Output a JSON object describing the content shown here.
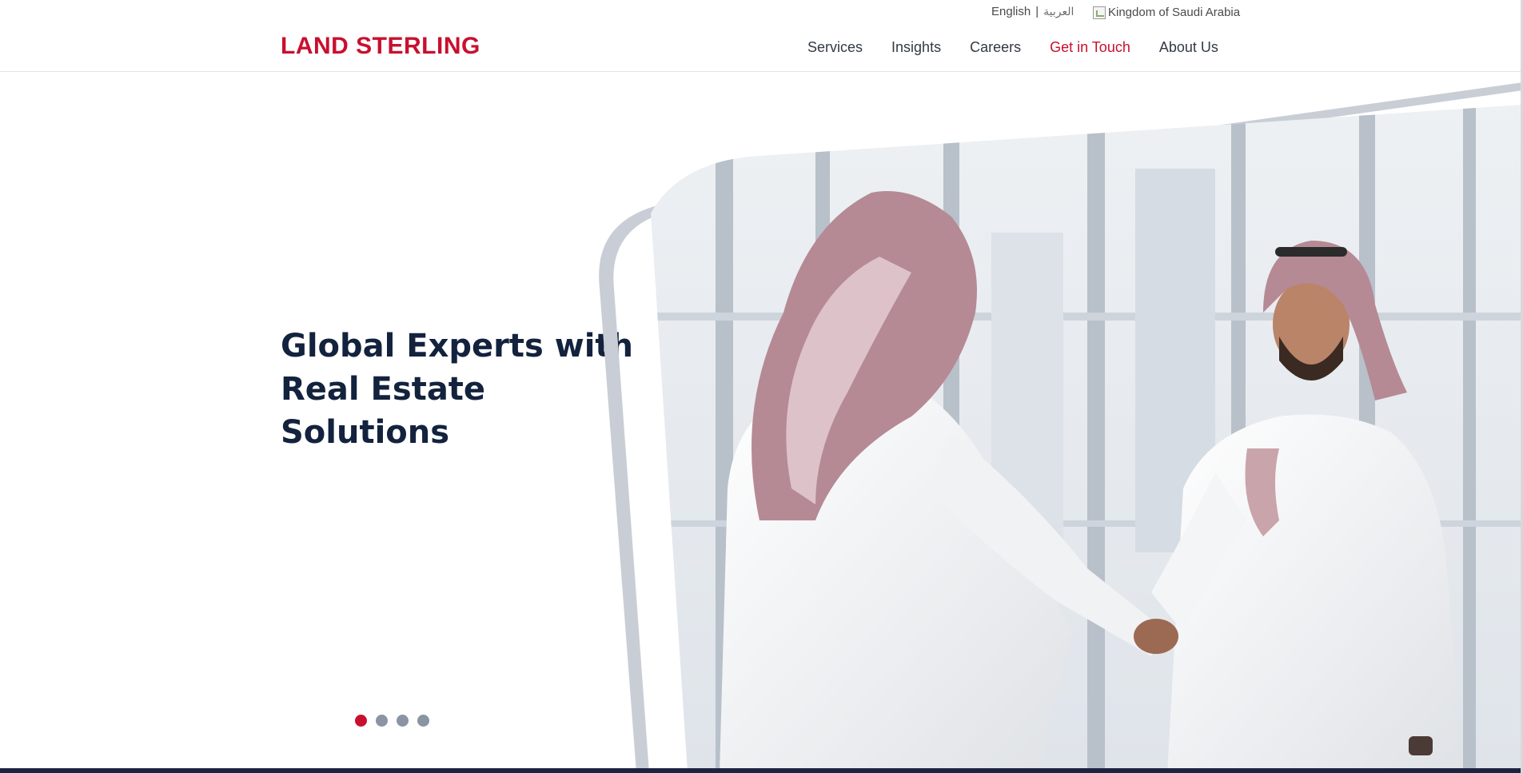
{
  "utility": {
    "lang_en": "English",
    "lang_sep": "|",
    "lang_ar": "العربية",
    "region": "Kingdom of Saudi Arabia"
  },
  "brand": {
    "logo": "LAND STERLING",
    "color": "#c8102e"
  },
  "nav": {
    "items": [
      {
        "label": "Services"
      },
      {
        "label": "Insights"
      },
      {
        "label": "Careers"
      },
      {
        "label": "Get in Touch"
      },
      {
        "label": "About Us"
      }
    ]
  },
  "hero": {
    "heading_lines": [
      "Global Experts with",
      "Real Estate",
      "Solutions"
    ],
    "slides_total": 4,
    "active_slide": 1
  },
  "colors": {
    "accent": "#c8102e",
    "heading": "#13223d",
    "nav_text": "#333a44",
    "dot_inactive": "#8a94a3"
  }
}
